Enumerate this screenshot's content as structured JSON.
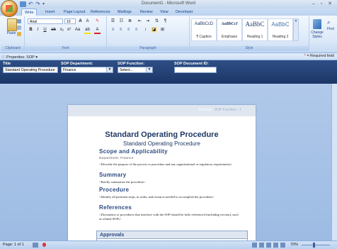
{
  "window": {
    "title": "Document1 - Microsoft Word",
    "controls": "– ▫ ✕"
  },
  "qat": {
    "undo_icon": "↶",
    "redo_icon": "↷",
    "more_icon": "▾"
  },
  "tabs": [
    "Write",
    "Insert",
    "Page Layout",
    "References",
    "Mailings",
    "Review",
    "View",
    "Developer"
  ],
  "ribbon": {
    "paste_label": "Paste",
    "font_name": "Arial",
    "font_size": "10",
    "styles": [
      {
        "sample": "AaBbCcD",
        "name": "¶ Caption"
      },
      {
        "sample": "AaBbCcI",
        "name": "Emphasis"
      },
      {
        "sample": "AaBbC",
        "name": "Heading 1"
      },
      {
        "sample": "AaBbC",
        "name": "Heading 2"
      }
    ],
    "change_styles_label": "Change Styles",
    "find_label": "Find",
    "groups": [
      "Clipboard",
      "Font",
      "Paragraph",
      "Style"
    ]
  },
  "properties": {
    "title": "Properties: SOP",
    "required_text": "= Required field",
    "required_mark": "*"
  },
  "docinfo": {
    "title_label": "Title",
    "title_value": "Standard Operating Procedure",
    "department_label": "SOP Department:",
    "department_value": "Finance",
    "function_label": "SOP Function:",
    "function_value": "Select...",
    "docid_label": "SOP Document ID:"
  },
  "page": {
    "header_dept": "Finance - ",
    "header_suffix": "SOP Function - 1",
    "title": "Standard Operating Procedure",
    "subtitle": "Standard Operating Procedure",
    "scope_heading": "Scope and Applicability",
    "department_line": "Department: Finance",
    "scope_text": "<Describe the purpose of the process or procedure and any organizational or regulatory requirements>",
    "summary_heading": "Summary",
    "summary_text": "<Briefly summarize the procedure>",
    "procedure_heading": "Procedure",
    "procedure_text": "<Identify all pertinent steps, in order, and resource needed to accomplish the procedure>",
    "references_heading": "References",
    "references_text": "<Documents or procedures that interface with the SOP should be fully referenced (including version), such as related SOPs>",
    "approvals_heading": "Approvals"
  },
  "status": {
    "page": "Page: 1 of 1",
    "zoom": "70%"
  }
}
